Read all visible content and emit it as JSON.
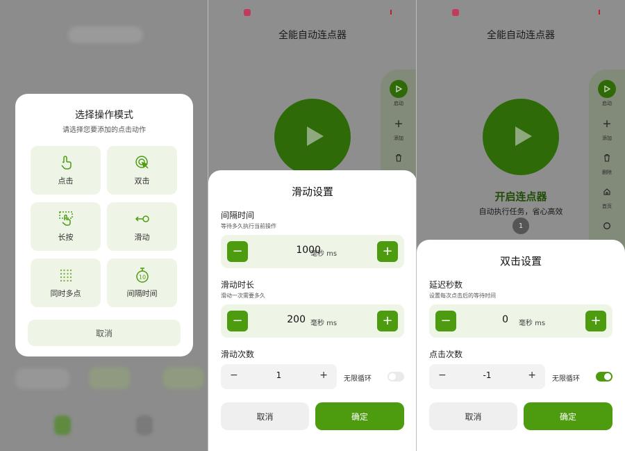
{
  "panel1": {
    "modal": {
      "title": "选择操作模式",
      "subtitle": "请选择您要添加的点击动作",
      "options": [
        {
          "label": "点击",
          "icon": "tap-icon"
        },
        {
          "label": "双击",
          "icon": "double-tap-icon"
        },
        {
          "label": "长按",
          "icon": "long-press-icon"
        },
        {
          "label": "滑动",
          "icon": "swipe-icon"
        },
        {
          "label": "同时多点",
          "icon": "multi-point-icon"
        },
        {
          "label": "间隔时间",
          "icon": "timer-icon"
        }
      ],
      "cancel_label": "取消"
    }
  },
  "app": {
    "title": "全能自动连点器",
    "rail": {
      "items": [
        {
          "label": "启动",
          "icon": "play-icon"
        },
        {
          "label": "添加",
          "icon": "plus-icon"
        },
        {
          "label": "删除",
          "icon": "trash-icon"
        },
        {
          "label": "首页",
          "icon": "home-icon"
        },
        {
          "label": "",
          "icon": "circle-icon"
        }
      ]
    },
    "start_title": "开启连点器",
    "start_subtitle": "自动执行任务，省心高效",
    "badge": "1"
  },
  "panel2": {
    "sheet_title": "滑动设置",
    "interval": {
      "title": "间隔时间",
      "subtitle": "等待多久执行当前操作",
      "value": "1000",
      "unit": "毫秒 ms",
      "minus": "−",
      "plus": "+"
    },
    "duration": {
      "title": "滑动时长",
      "subtitle": "滑动一次需要多久",
      "value": "200",
      "unit": "毫秒 ms",
      "minus": "−",
      "plus": "+"
    },
    "count": {
      "title": "滑动次数",
      "value": "1",
      "minus": "−",
      "plus": "+",
      "loop_label": "无限循环",
      "loop_on": false
    },
    "cancel_label": "取消",
    "ok_label": "确定"
  },
  "panel3": {
    "sheet_title": "双击设置",
    "delay": {
      "title": "延迟秒数",
      "subtitle": "设置每次点击后的等待时间",
      "value": "0",
      "unit": "毫秒 ms",
      "minus": "−",
      "plus": "+"
    },
    "count": {
      "title": "点击次数",
      "value": "-1",
      "minus": "−",
      "plus": "+",
      "loop_label": "无限循环",
      "loop_on": true
    },
    "cancel_label": "取消",
    "ok_label": "确定"
  },
  "colors": {
    "accent": "#4d9c10",
    "accent_dark": "#2f6a08",
    "tile_bg": "#eef4e6"
  }
}
